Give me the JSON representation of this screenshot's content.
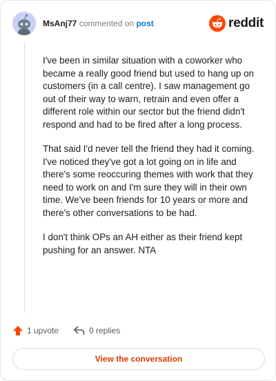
{
  "comment": {
    "username": "MsAnj77",
    "action": "commented on",
    "link_text": "post",
    "paragraphs": [
      "I've been in similar situation with a coworker who became a really good friend but used to hang up on customers (in a call centre). I saw management go out of their way to warn, retrain and even offer a different role within our sector but the friend didn't respond and had to be fired after a long process.",
      "That said I'd never tell the friend they had it coming. I've noticed they've got a lot going on in life and there's some reoccuring themes with work that they need to work on and I'm sure they will in their own time. We've been friends for 10 years or more and there's other conversations to be had.",
      "I don't think OPs an AH either as their friend kept pushing for an answer. NTA"
    ]
  },
  "brand": {
    "name": "reddit",
    "logo_icon": "reddit-snoo-icon",
    "color": "#ff4500"
  },
  "footer": {
    "upvote_label": "1 upvote",
    "upvote_icon": "upvote-arrow-icon",
    "replies_label": "0 replies",
    "replies_icon": "reply-arrow-icon"
  },
  "cta": {
    "label": "View the conversation",
    "color": "#d93a00"
  }
}
